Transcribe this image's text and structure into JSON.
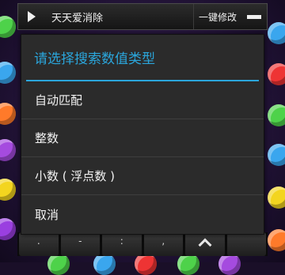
{
  "toolbar": {
    "app_title": "天天爱消除",
    "modify_label": "一键修改",
    "play_icon": "play-icon",
    "menu_icon": "menu-icon"
  },
  "dialog": {
    "title": "请选择搜索数值类型",
    "options": [
      "自动匹配",
      "整数",
      "小数 ( 浮点数 )",
      "取消"
    ]
  },
  "keyboard": {
    "keys": [
      ".",
      "-",
      ":",
      ","
    ],
    "caret_icon": "caret-up-icon"
  },
  "colors": {
    "accent": "#2ba6dc",
    "dialog_bg": "#2b2b2b",
    "toolbar_bg": "#1e1e1e"
  }
}
